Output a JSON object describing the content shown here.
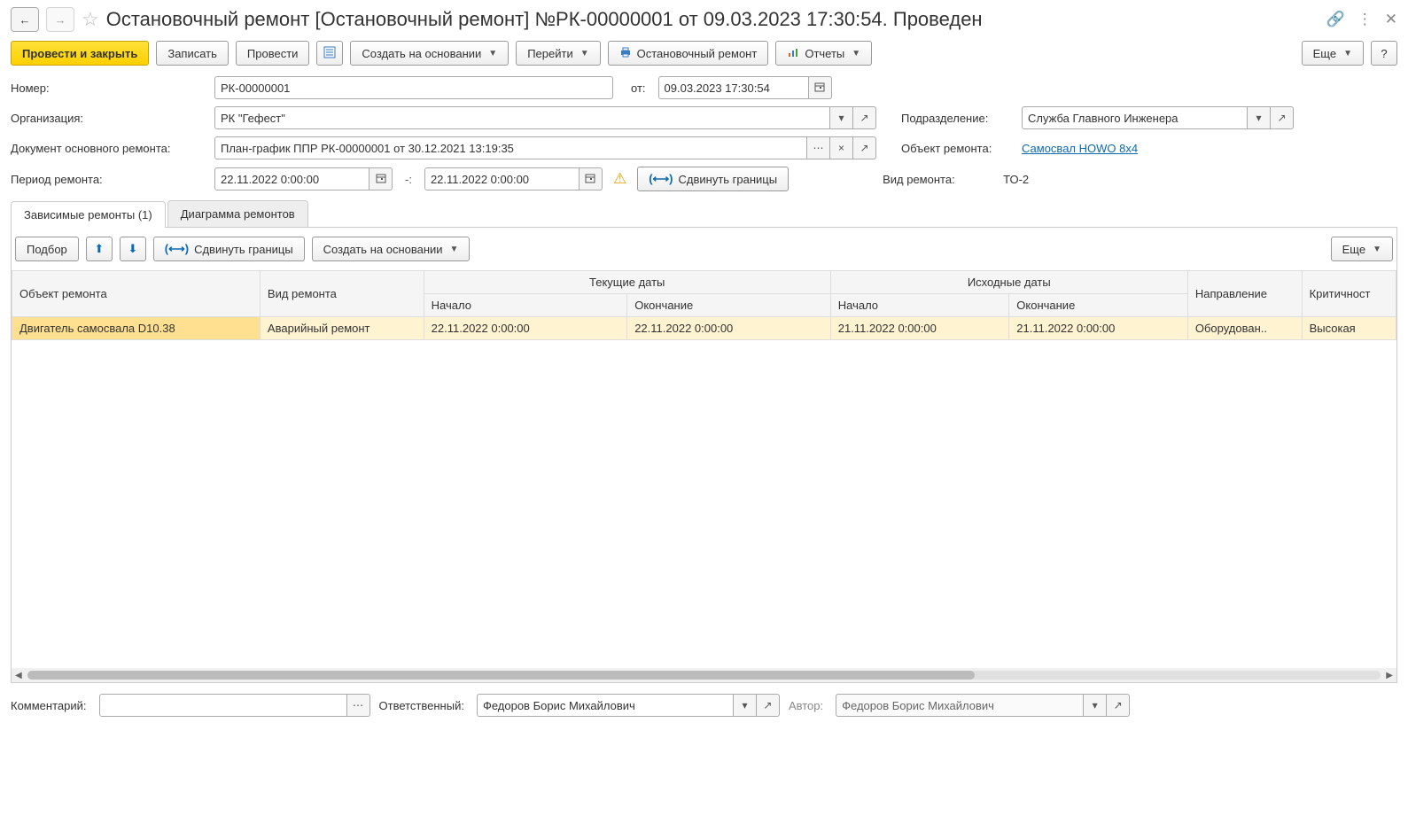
{
  "title": "Остановочный ремонт [Остановочный ремонт] №РК-00000001 от 09.03.2023 17:30:54. Проведен",
  "toolbar": {
    "post_close": "Провести и закрыть",
    "save": "Записать",
    "post": "Провести",
    "create_based": "Создать на основании",
    "goto": "Перейти",
    "print_doc": "Остановочный ремонт",
    "reports": "Отчеты",
    "more": "Еще",
    "help": "?"
  },
  "form": {
    "number_label": "Номер:",
    "number_value": "РК-00000001",
    "from_label": "от:",
    "date_value": "09.03.2023 17:30:54",
    "org_label": "Организация:",
    "org_value": "РК \"Гефест\"",
    "dept_label": "Подразделение:",
    "dept_value": "Служба Главного Инженера",
    "basedoc_label": "Документ основного ремонта:",
    "basedoc_value": "План-график ППР РК-00000001 от 30.12.2021 13:19:35",
    "object_label": "Объект ремонта:",
    "object_value": "Самосвал HOWO 8x4",
    "period_label": "Период ремонта:",
    "period_from": "22.11.2022  0:00:00",
    "period_sep": "-:",
    "period_to": "22.11.2022  0:00:00",
    "shift": "Сдвинуть границы",
    "repair_type_label": "Вид ремонта:",
    "repair_type_value": "ТО-2"
  },
  "tabs": {
    "tab1": "Зависимые ремонты (1)",
    "tab2": "Диаграмма ремонтов"
  },
  "tab_toolbar": {
    "pick": "Подбор",
    "shift": "Сдвинуть границы",
    "create_based": "Создать на основании",
    "more": "Еще"
  },
  "grid": {
    "headers": {
      "obj": "Объект ремонта",
      "type": "Вид ремонта",
      "current_dates": "Текущие даты",
      "source_dates": "Исходные даты",
      "direction": "Направление",
      "critical": "Критичност",
      "start": "Начало",
      "end": "Окончание"
    },
    "row": {
      "obj": "Двигатель самосвала D10.38",
      "type": "Аварийный ремонт",
      "cur_start": "22.11.2022 0:00:00",
      "cur_end": "22.11.2022 0:00:00",
      "src_start": "21.11.2022 0:00:00",
      "src_end": "21.11.2022 0:00:00",
      "direction": "Оборудован..",
      "critical": "Высокая"
    }
  },
  "footer": {
    "comment_label": "Комментарий:",
    "comment_value": "",
    "responsible_label": "Ответственный:",
    "responsible_value": "Федоров Борис Михайлович",
    "author_label": "Автор:",
    "author_value": "Федоров Борис Михайлович"
  }
}
